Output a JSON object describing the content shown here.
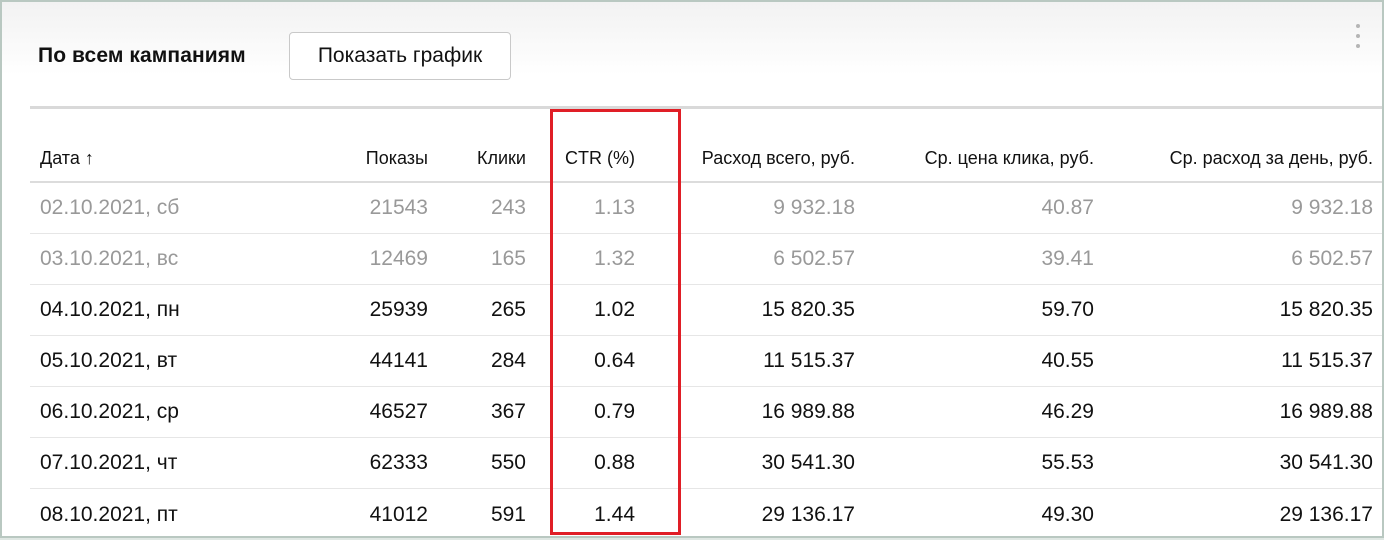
{
  "header": {
    "title": "По всем кампаниям",
    "show_chart_button": "Показать график"
  },
  "table": {
    "columns": [
      "Дата ↑",
      "Показы",
      "Клики",
      "CTR (%)",
      "Расход всего, руб.",
      "Ср. цена клика, руб.",
      "Ср. расход за день, руб."
    ],
    "rows": [
      {
        "weekend": true,
        "cells": [
          "02.10.2021, сб",
          "21543",
          "243",
          "1.13",
          "9 932.18",
          "40.87",
          "9 932.18"
        ]
      },
      {
        "weekend": true,
        "cells": [
          "03.10.2021, вс",
          "12469",
          "165",
          "1.32",
          "6 502.57",
          "39.41",
          "6 502.57"
        ]
      },
      {
        "weekend": false,
        "cells": [
          "04.10.2021, пн",
          "25939",
          "265",
          "1.02",
          "15 820.35",
          "59.70",
          "15 820.35"
        ]
      },
      {
        "weekend": false,
        "cells": [
          "05.10.2021, вт",
          "44141",
          "284",
          "0.64",
          "11 515.37",
          "40.55",
          "11 515.37"
        ]
      },
      {
        "weekend": false,
        "cells": [
          "06.10.2021, ср",
          "46527",
          "367",
          "0.79",
          "16 989.88",
          "46.29",
          "16 989.88"
        ]
      },
      {
        "weekend": false,
        "cells": [
          "07.10.2021, чт",
          "62333",
          "550",
          "0.88",
          "30 541.30",
          "55.53",
          "30 541.30"
        ]
      },
      {
        "weekend": false,
        "cells": [
          "08.10.2021, пт",
          "41012",
          "591",
          "1.44",
          "29 136.17",
          "49.30",
          "29 136.17"
        ]
      }
    ]
  },
  "colors": {
    "highlight": "#e01e26",
    "weekend_text": "#999999",
    "text": "#111111"
  }
}
